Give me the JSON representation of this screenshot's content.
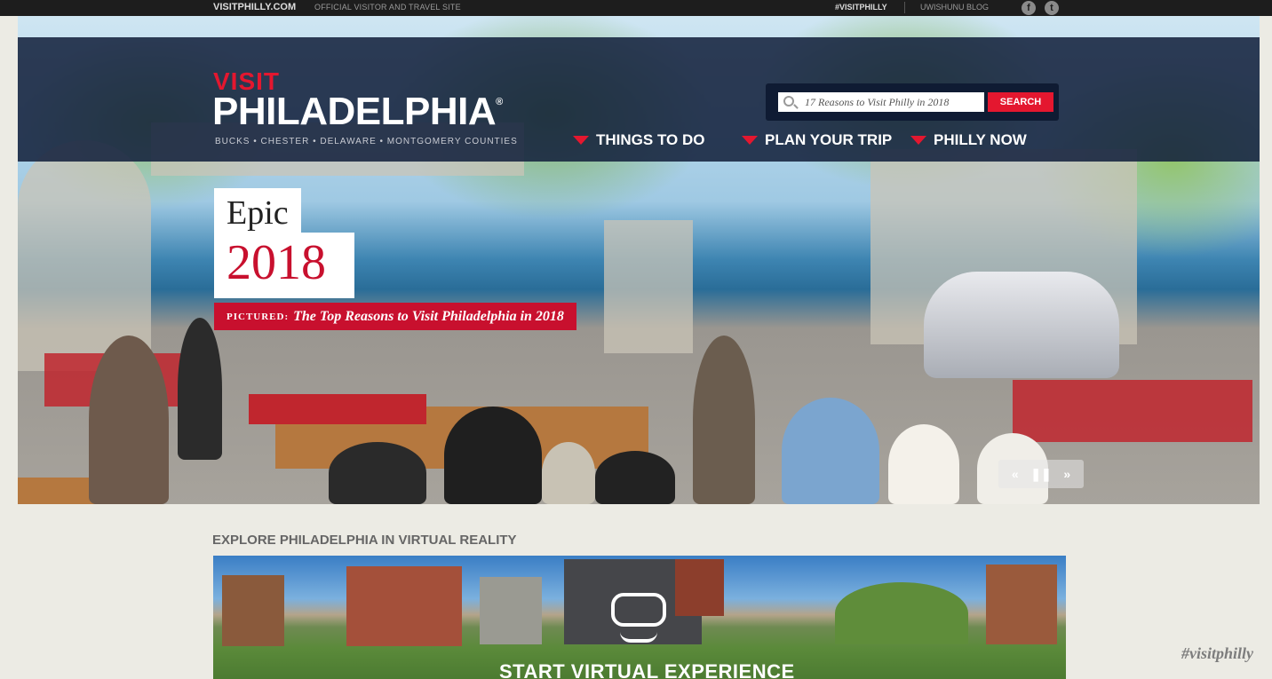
{
  "topbar": {
    "site": "VISITPHILLY.COM",
    "tagline": "OFFICIAL VISITOR AND TRAVEL SITE",
    "hashtag": "#VISITPHILLY",
    "blog": "UWISHUNU BLOG",
    "social": [
      "facebook-icon",
      "twitter-icon"
    ]
  },
  "header": {
    "logo_visit": "VISIT",
    "logo_philadelphia": "PHILADELPHIA",
    "logo_registered": "®",
    "counties": "BUCKS • CHESTER • DELAWARE • MONTGOMERY COUNTIES",
    "search": {
      "placeholder": "17 Reasons to Visit Philly in 2018",
      "button": "SEARCH"
    },
    "nav": [
      {
        "label": "THINGS TO DO"
      },
      {
        "label": "PLAN YOUR TRIP"
      },
      {
        "label": "PHILLY NOW"
      }
    ]
  },
  "hero": {
    "line1": "Epic",
    "line2": "2018",
    "pictured_prefix": "PICTURED:",
    "pictured_title": "The Top Reasons to Visit Philadelphia in 2018",
    "controls": {
      "prev": "«",
      "pause": "❚❚",
      "next": "»"
    }
  },
  "vr": {
    "heading": "EXPLORE PHILADELPHIA IN VIRTUAL REALITY",
    "cta": "START VIRTUAL EXPERIENCE"
  },
  "footer_hashtag": "#visitphilly",
  "colors": {
    "brand_red": "#e4172f",
    "navy": "#14223e"
  }
}
